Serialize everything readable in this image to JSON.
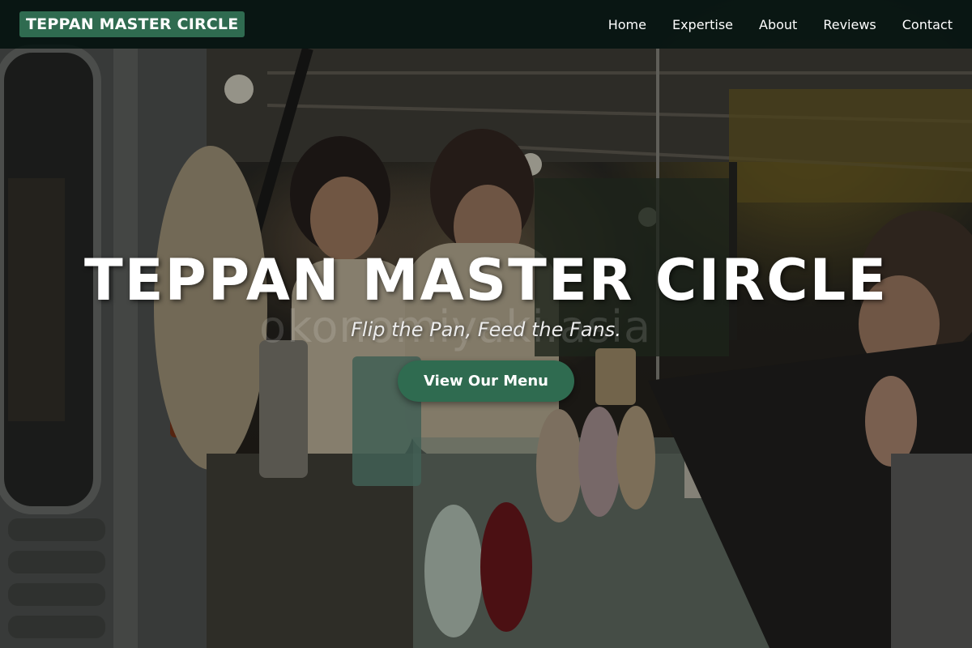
{
  "navbar": {
    "brand": "TEPPAN MASTER CIRCLE",
    "links": [
      {
        "label": "Home"
      },
      {
        "label": "Expertise"
      },
      {
        "label": "About"
      },
      {
        "label": "Reviews"
      },
      {
        "label": "Contact"
      }
    ]
  },
  "hero": {
    "title": "TEPPAN MASTER CIRCLE",
    "tagline": "Flip the Pan, Feed the Fans.",
    "cta_label": "View Our Menu",
    "background_watermark": "okonomiyaki.asia"
  },
  "colors": {
    "accent": "#2f6b50",
    "navbar_bg": "#08161299",
    "text": "#ffffff"
  }
}
